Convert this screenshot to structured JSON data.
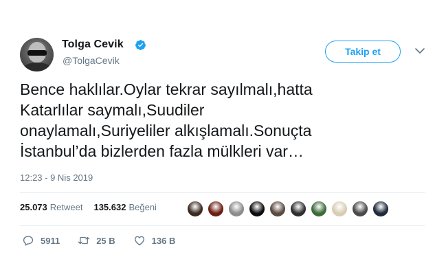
{
  "user": {
    "name": "Tolga Cevik",
    "handle": "@TolgaCevik"
  },
  "follow_button": {
    "label": "Takip et"
  },
  "tweet": {
    "text": "Bence haklılar.Oylar tekrar sayılmalı,hatta\nKatarlılar saymalı,Suudiler\nonaylamalı,Suriyeliler alkışlamalı.Sonuçta\nİstanbul’da bizlerden fazla mülkleri var…",
    "timestamp": "12:23 - 9 Nis 2019"
  },
  "stats": {
    "retweets": "25.073",
    "retweets_label": "Retweet",
    "likes": "135.632",
    "likes_label": "Beğeni"
  },
  "likers": [
    {
      "color": "#3b2a1f"
    },
    {
      "color": "#6b1e12"
    },
    {
      "color": "#8c8c8c"
    },
    {
      "color": "#0d0d0d"
    },
    {
      "color": "#5a4a40"
    },
    {
      "color": "#2f2f2f"
    },
    {
      "color": "#3d6b3a"
    },
    {
      "color": "#d8cdb4"
    },
    {
      "color": "#4a4a4a"
    },
    {
      "color": "#1f2a3a"
    }
  ],
  "actions": {
    "replies": "5911",
    "retweets": "25 B",
    "likes": "136 B"
  },
  "colors": {
    "accent": "#1da1f2",
    "muted": "#657786",
    "text": "#14171a"
  },
  "icons": [
    "verified-badge-icon",
    "chevron-down-icon",
    "reply-icon",
    "retweet-icon",
    "like-icon"
  ]
}
